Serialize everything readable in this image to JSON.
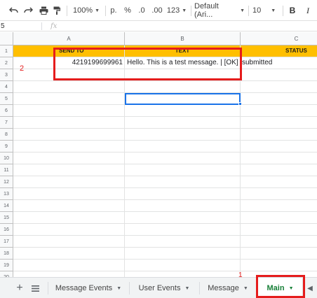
{
  "toolbar": {
    "undo_icon": "undo-icon",
    "redo_icon": "redo-icon",
    "print_icon": "print-icon",
    "paint_format_icon": "paint-format-icon",
    "zoom": "100%",
    "currency_label": "p.",
    "percent_label": "%",
    "decrease_decimal_label": ".0",
    "increase_decimal_label": ".00",
    "more_formats_label": "123",
    "font_family": "Default (Ari...",
    "font_size": "10",
    "bold_label": "B",
    "italic_label": "I"
  },
  "formula_bar": {
    "name_box": "5",
    "fx_label": "fx",
    "value": ""
  },
  "columns": [
    {
      "label": "A"
    },
    {
      "label": "B"
    },
    {
      "label": "C"
    }
  ],
  "rows": [
    "1",
    "2",
    "3",
    "4",
    "5",
    "6",
    "7",
    "8",
    "9",
    "10",
    "11",
    "12",
    "13",
    "14",
    "15",
    "16",
    "17",
    "18",
    "19",
    "20"
  ],
  "sheet": {
    "row1": {
      "a": "SEND TO",
      "b": "TEXT",
      "c": "STATUS"
    },
    "row2": {
      "a": "4219199699961",
      "b": "Hello. This is a test message. | [OK]",
      "c": "submitted"
    }
  },
  "annotations": {
    "label_2": "2",
    "label_1": "1"
  },
  "tabs": {
    "add_icon": "plus-icon",
    "all_sheets_icon": "menu-icon",
    "items": [
      {
        "label": "Message Events"
      },
      {
        "label": "User Events"
      },
      {
        "label": "Message"
      },
      {
        "label": "Main"
      }
    ],
    "scroll_left_icon": "chevron-left-icon"
  },
  "colors": {
    "header_fill": "#ffbf00",
    "active_tab_text": "#188038",
    "selection": "#1a73e8",
    "annotation_red": "#e51c1c"
  }
}
